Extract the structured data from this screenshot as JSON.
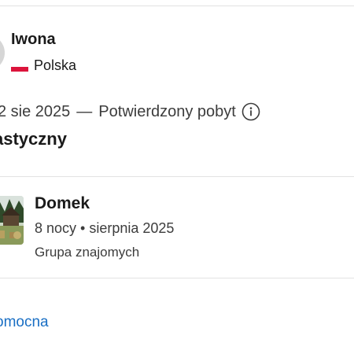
{
  "reviewer": {
    "name": "Iwona",
    "country": "Polska"
  },
  "stay": {
    "date": "2 sie 2025",
    "separator": "—",
    "status": "Potwierdzony pobyt"
  },
  "review": {
    "title": "astyczny"
  },
  "property": {
    "name": "Domek",
    "stay_summary": "8 nocy • sierpnia 2025",
    "traveler_type": "Grupa znajomych"
  },
  "actions": {
    "helpful_label": "omocna"
  },
  "icons": {
    "info": "info-icon",
    "flag": "poland-flag-icon"
  },
  "colors": {
    "link": "#1a6fc4",
    "flag_red": "#dc143c",
    "text_secondary": "#3c3c3c",
    "divider": "#e2e2e2"
  }
}
